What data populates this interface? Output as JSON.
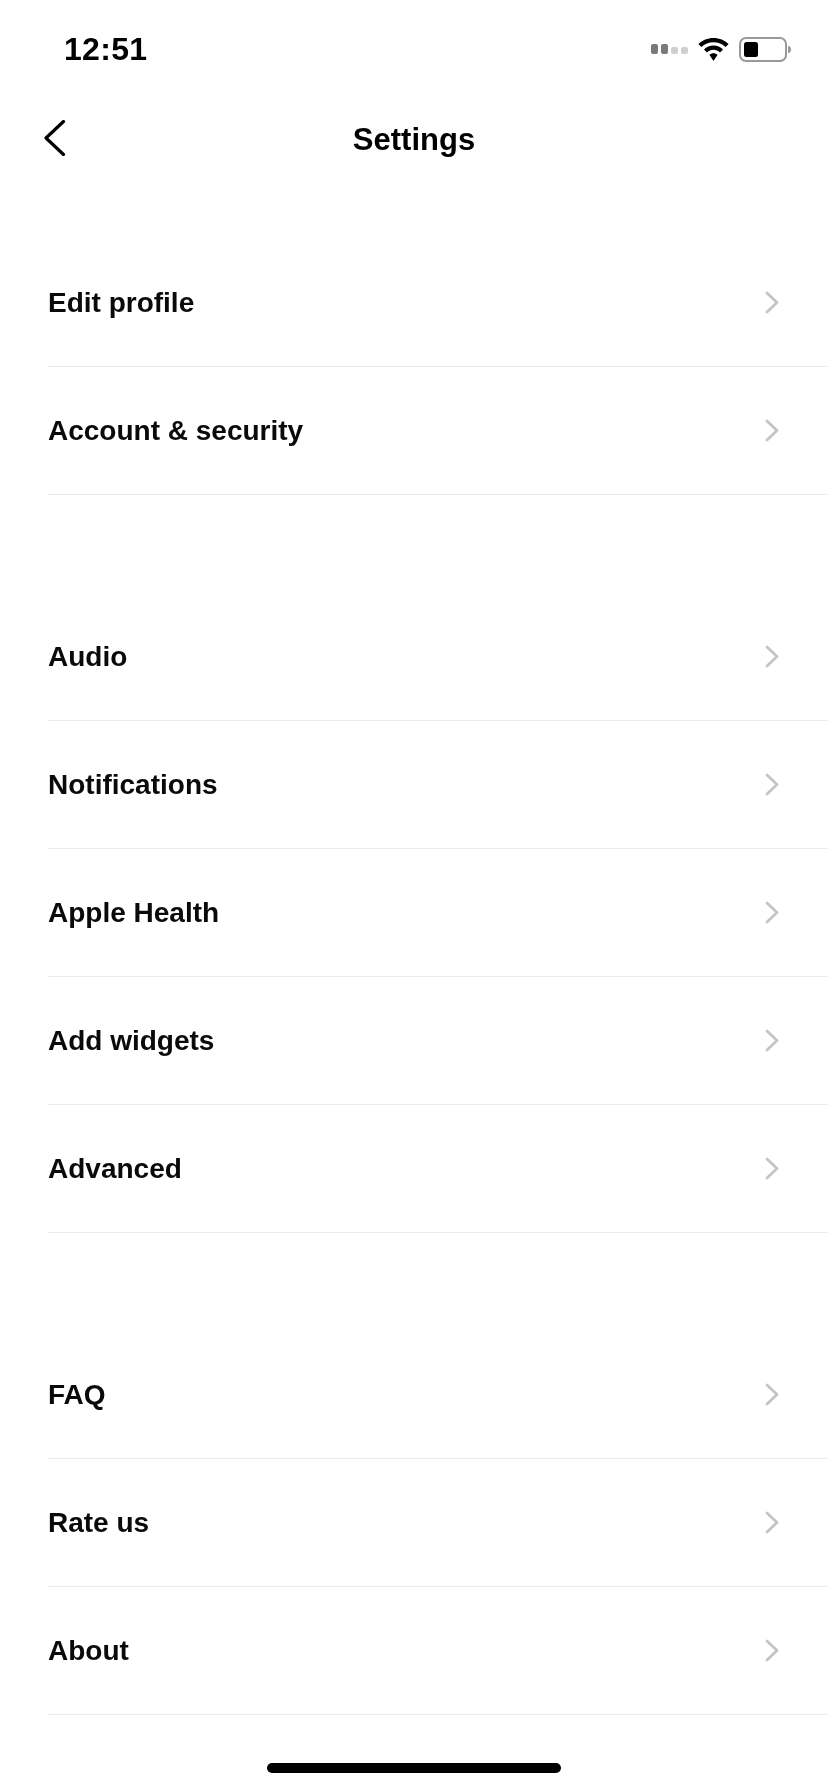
{
  "status_bar": {
    "time": "12:51"
  },
  "header": {
    "title": "Settings"
  },
  "sections": [
    {
      "items": [
        {
          "label": "Edit profile"
        },
        {
          "label": "Account & security"
        }
      ]
    },
    {
      "items": [
        {
          "label": "Audio"
        },
        {
          "label": "Notifications"
        },
        {
          "label": "Apple Health"
        },
        {
          "label": "Add widgets"
        },
        {
          "label": "Advanced"
        }
      ]
    },
    {
      "items": [
        {
          "label": "FAQ"
        },
        {
          "label": "Rate us"
        },
        {
          "label": "About"
        }
      ]
    }
  ]
}
